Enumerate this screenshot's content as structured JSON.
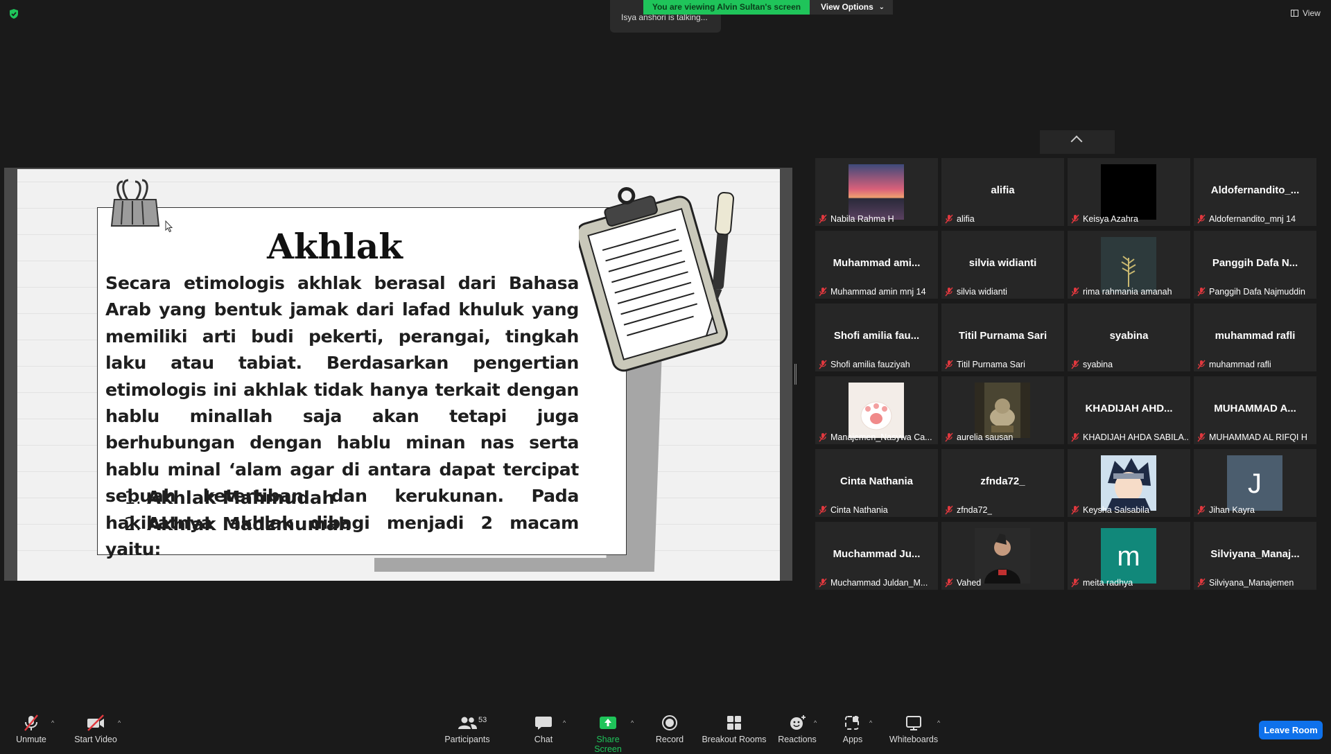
{
  "top": {
    "talking": "Isya anshori is talking...",
    "banner": "You are viewing Alvin Sultan's screen",
    "view_options": "View Options",
    "view": "View"
  },
  "slide": {
    "title": "Akhlak",
    "body": "Secara etimologis akhlak berasal dari Bahasa Arab yang bentuk jamak dari lafad khuluk yang memiliki arti budi pekerti, perangai, tingkah laku atau tabiat. Berdasarkan pengertian etimologis ini akhlak tidak hanya terkait dengan hablu minallah saja akan tetapi juga berhubungan dengan hablu minan nas serta hablu minal ‘alam agar di antara dapat tercipat sebuah ketertiban dan kerukunan. Pada hakikatnya akhlak dibagi menjadi 2 macam yaitu:",
    "list": [
      {
        "num": "1.",
        "text": "Akhlak Mahmudah"
      },
      {
        "num": "2.",
        "text": "Akhlak Madzmumah"
      }
    ]
  },
  "gallery": [
    {
      "big": "",
      "label": "Nabila Rahma H",
      "avatar": "sunset"
    },
    {
      "big": "alifia",
      "label": "alifia",
      "avatar": ""
    },
    {
      "big": "",
      "label": "Keisya Azahra",
      "avatar": "black"
    },
    {
      "big": "Aldofernandito_...",
      "label": "Aldofernandito_mnj 14",
      "avatar": ""
    },
    {
      "big": "Muhammad ami...",
      "label": "Muhammad amin mnj 14",
      "avatar": ""
    },
    {
      "big": "silvia widianti",
      "label": "silvia widianti",
      "avatar": ""
    },
    {
      "big": "",
      "label": "rima rahmania amanah",
      "avatar": "plant"
    },
    {
      "big": "Panggih Dafa N...",
      "label": "Panggih Dafa Najmuddin",
      "avatar": ""
    },
    {
      "big": "Shofi amilia fau...",
      "label": "Shofi amilia fauziyah",
      "avatar": ""
    },
    {
      "big": "Titil Purnama Sari",
      "label": "Titil Purnama Sari",
      "avatar": ""
    },
    {
      "big": "syabina",
      "label": "syabina",
      "avatar": ""
    },
    {
      "big": "muhammad rafli",
      "label": "muhammad rafli",
      "avatar": ""
    },
    {
      "big": "",
      "label": "Manajemen_Nasywa Ca...",
      "avatar": "paw"
    },
    {
      "big": "",
      "label": "aurelia sausan",
      "avatar": "cat"
    },
    {
      "big": "KHADIJAH AHD...",
      "label": "KHADIJAH AHDA SABILA...",
      "avatar": ""
    },
    {
      "big": "MUHAMMAD A...",
      "label": "MUHAMMAD AL RIFQI H",
      "avatar": ""
    },
    {
      "big": "Cinta Nathania",
      "label": "Cinta Nathania",
      "avatar": ""
    },
    {
      "big": "zfnda72_",
      "label": "zfnda72_",
      "avatar": ""
    },
    {
      "big": "",
      "label": "Keysha Salsabila",
      "avatar": "anime"
    },
    {
      "big": "",
      "label": "Jihan Kayra",
      "avatar": "letter-J"
    },
    {
      "big": "Muchammad Ju...",
      "label": "Muchammad Juldan_M...",
      "avatar": ""
    },
    {
      "big": "",
      "label": "Vahed",
      "avatar": "person"
    },
    {
      "big": "",
      "label": "meita radhya",
      "avatar": "letter-m"
    },
    {
      "big": "Silviyana_Manaj...",
      "label": "Silviyana_Manajemen",
      "avatar": ""
    }
  ],
  "toolbar": {
    "unmute": "Unmute",
    "start_video": "Start Video",
    "participants": "Participants",
    "participants_count": "53",
    "chat": "Chat",
    "share_screen": "Share Screen",
    "record": "Record",
    "breakout_rooms": "Breakout Rooms",
    "reactions": "Reactions",
    "apps": "Apps",
    "whiteboards": "Whiteboards",
    "leave_room": "Leave Room"
  },
  "colors": {
    "share_green": "#1fc45a",
    "leave_blue": "#0e71eb",
    "muted_red": "#e0383e",
    "avatar_slate": "#4b5d6e",
    "avatar_teal": "#11887a"
  }
}
